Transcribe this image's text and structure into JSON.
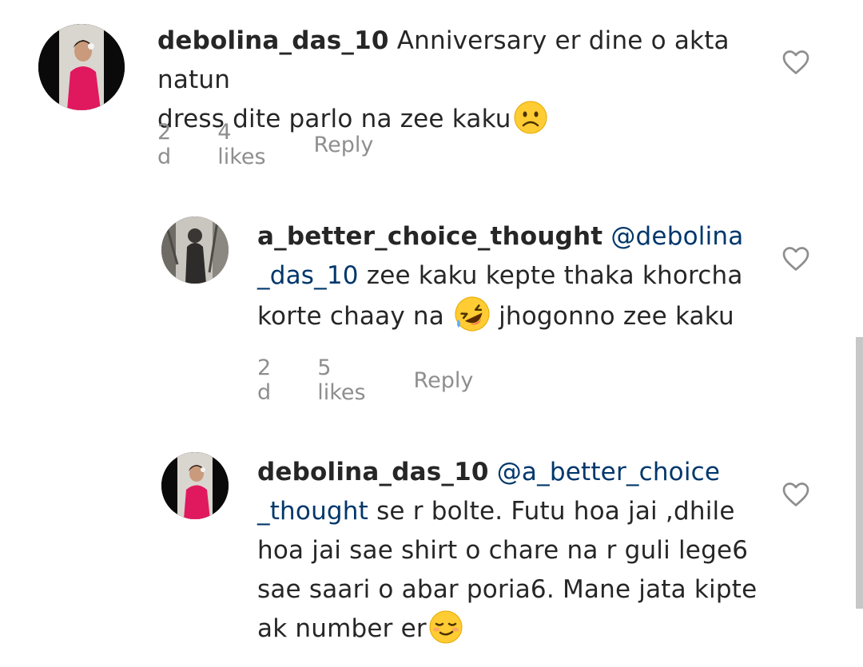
{
  "comments": [
    {
      "username": "debolina_das_10",
      "mention": "",
      "text_part1": "Anniversary er dine o akta natun",
      "text_part2": "dress dite parlo na zee kaku",
      "emoji": "sad-face-emoji",
      "time": "2 d",
      "likes": "4 likes",
      "reply_label": "Reply"
    },
    {
      "username": "a_better_choice_thought",
      "mention_part1": "@debolina",
      "mention_part2": "_das_10",
      "text_part1": "zee kaku kepte thaka  khorcha",
      "text_part2": "korte chaay na",
      "text_part3": "jhogonno zee kaku",
      "emoji": "rolling-laughing-emoji",
      "time": "2 d",
      "likes": "5 likes",
      "reply_label": "Reply"
    },
    {
      "username": "debolina_das_10",
      "mention_part1": "@a_better_choice",
      "mention_part2": "_thought",
      "text_part1": "se r bolte. Futu hoa jai ,dhile",
      "text_part2": "hoa jai sae shirt o chare na r guli lege6",
      "text_part3": "sae saari o abar poria6. Mane jata kipte",
      "text_part4": "ak number er",
      "emoji": "smirk-emoji"
    }
  ],
  "colors": {
    "text": "#262626",
    "mention": "#00376b",
    "meta": "#8e8e8e",
    "emoji_yellow": "#ffcc33"
  }
}
